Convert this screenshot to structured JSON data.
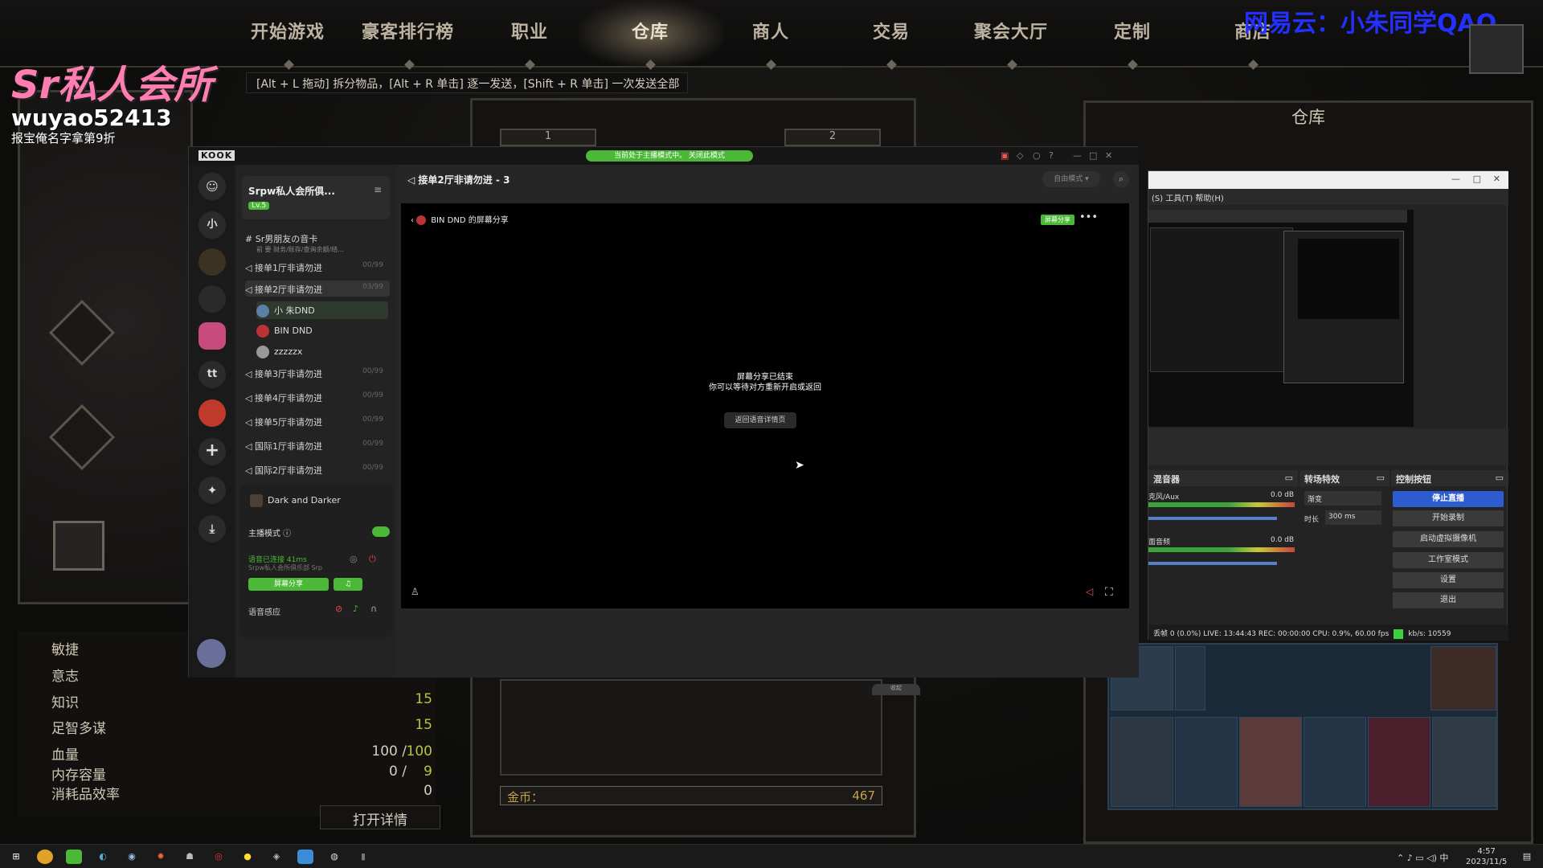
{
  "game": {
    "nav": [
      "开始游戏",
      "豪客排行榜",
      "职业",
      "仓库",
      "商人",
      "交易",
      "聚会大厅",
      "定制",
      "商店"
    ],
    "active_nav": "仓库",
    "hint": "[Alt + L 拖动] 拆分物品，[Alt + R 单击] 逐一发送，[Shift + R 单击] 一次发送全部",
    "watermark": "网易云：小朱同学QAQ",
    "logo": {
      "line1": "Sr私人会所",
      "line2": "wuyao52413",
      "line3": "报宝俺名字拿第9折"
    },
    "mid_tabs": [
      "1",
      "2"
    ],
    "stats": [
      {
        "label": "敏捷",
        "value": "",
        "max": ""
      },
      {
        "label": "意志",
        "value": "",
        "max": ""
      },
      {
        "label": "知识",
        "value": "",
        "max": "15"
      },
      {
        "label": "足智多谋",
        "value": "",
        "max": "15"
      },
      {
        "label": "血量",
        "value": "100 /",
        "max": "100"
      },
      {
        "label": "内存容量",
        "value": "0 /",
        "max": "9"
      },
      {
        "label": "消耗品效率",
        "value": "0",
        "max": ""
      }
    ],
    "open_detail": "打开详情",
    "gold_label": "金币：",
    "gold_value": "467",
    "stash_title": "仓库"
  },
  "kook": {
    "logo": "KOOK",
    "banner": "当前处于主播模式中。  关闭此模式",
    "servers": [
      "小",
      "tt"
    ],
    "guild_name": "Srpw私人会所俱...",
    "guild_level": "Lv.5",
    "text_channel": "Sr男朋友の音卡",
    "text_channel_sub": "前 要 财务/账存/查询余额/结...",
    "channels": [
      {
        "name": "接单1厅非请勿进",
        "count": "00/99"
      },
      {
        "name": "接单2厅非请勿进",
        "count": "03/99"
      },
      {
        "name": "接单3厅非请勿进",
        "count": "00/99"
      },
      {
        "name": "接单4厅非请勿进",
        "count": "00/99"
      },
      {
        "name": "接单5厅非请勿进",
        "count": "00/99"
      },
      {
        "name": "国际1厅非请勿进",
        "count": "00/99"
      },
      {
        "name": "国际2厅非请勿进",
        "count": "00/99"
      }
    ],
    "members": [
      "小 朱DND",
      "BIN DND",
      "zzzzzx"
    ],
    "activity": "Dark and Darker",
    "streamer_mode": "主播模式 ⓘ",
    "voice_status": "语音已连接 41ms",
    "voice_sub": "Srpw私人会所俱乐部 Srp",
    "share_btn": "屏幕分享",
    "voice_sense": "语音感应",
    "channel_header": "接单2厅非请勿进 - 3",
    "mode_btn": "自由模式 ▾",
    "video_title": "BIN DND 的屏幕分享",
    "video_badge": "屏幕分享",
    "end_msg1": "屏幕分享已结束",
    "end_msg2": "你可以等待对方重新开启或返回",
    "back_btn": "返回语音详情页",
    "collapse": "收起"
  },
  "obs": {
    "menu": "(S)    工具(T)    帮助(H)",
    "mixer_title": "混音器",
    "transition_title": "转场特效",
    "controls_title": "控制按钮",
    "mic_label": "克风/Aux",
    "mic_db": "0.0 dB",
    "desktop_label": "面音频",
    "desktop_db": "0.0 dB",
    "transition": "渐变",
    "duration_label": "时长",
    "duration": "300 ms",
    "buttons": [
      "停止直播",
      "开始录制",
      "启动虚拟摄像机",
      "工作室模式",
      "设置",
      "退出"
    ],
    "status": "丢帧 0 (0.0%)   LIVE: 13:44:43   REC: 00:00:00   CPU: 0.9%, 60.00 fps",
    "kbps": "kb/s: 10559"
  },
  "taskbar": {
    "time": "4:57",
    "date": "2023/11/5",
    "ime": "中"
  }
}
